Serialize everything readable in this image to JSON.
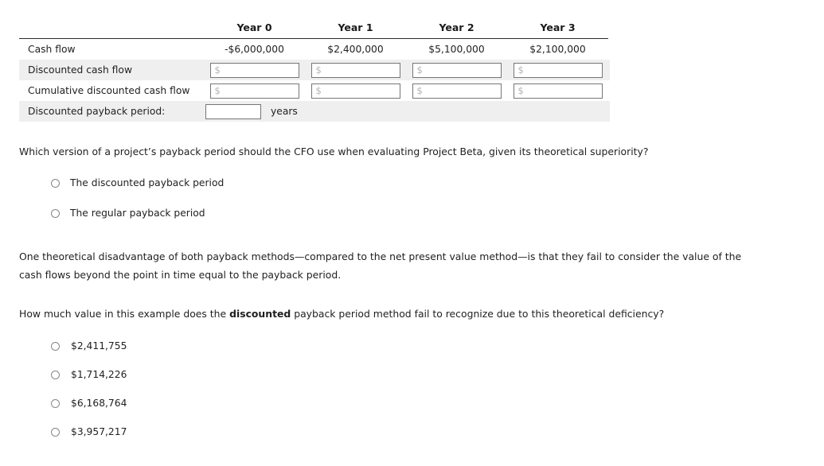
{
  "table": {
    "columns": [
      "Year 0",
      "Year 1",
      "Year 2",
      "Year 3"
    ],
    "rows": [
      {
        "label": "Cash flow",
        "type": "values",
        "shaded": false,
        "values": [
          "-$6,000,000",
          "$2,400,000",
          "$5,100,000",
          "$2,100,000"
        ]
      },
      {
        "label": "Discounted cash flow",
        "type": "inputs",
        "shaded": true,
        "values": [
          "",
          "",
          "",
          ""
        ],
        "placeholder": "$"
      },
      {
        "label": "Cumulative discounted cash flow",
        "type": "inputs",
        "shaded": false,
        "values": [
          "",
          "",
          "",
          ""
        ],
        "placeholder": "$"
      },
      {
        "label": "Discounted payback period:",
        "type": "payback",
        "shaded": true,
        "value": "",
        "unit": "years"
      }
    ]
  },
  "question1": {
    "prompt": "Which version of a project’s payback period should the CFO use when evaluating Project Beta, given its theoretical superiority?",
    "options": [
      {
        "label": "The discounted payback period"
      },
      {
        "label": "The regular payback period"
      }
    ]
  },
  "paragraph": {
    "part1": "One theoretical disadvantage of both payback methods—compared to the net present value method—is that they fail to consider the value of the cash flows beyond the point in time equal to the payback period."
  },
  "question2": {
    "prompt_before": "How much value in this example does the ",
    "prompt_bold": "discounted",
    "prompt_after": " payback period method fail to recognize due to this theoretical deficiency?",
    "options": [
      {
        "label": "$2,411,755"
      },
      {
        "label": "$1,714,226"
      },
      {
        "label": "$6,168,764"
      },
      {
        "label": "$3,957,217"
      }
    ]
  }
}
